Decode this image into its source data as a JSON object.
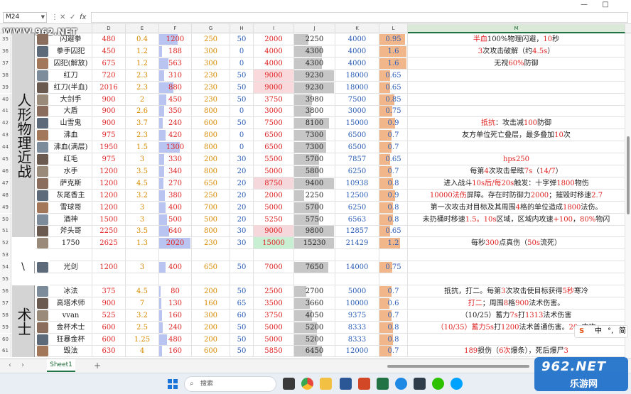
{
  "window": {
    "minimize": "—",
    "maximize": "□"
  },
  "formula_bar": {
    "name_box": "M24",
    "fx": "fx"
  },
  "watermark": "WWW.962.NET",
  "columns": [
    "D",
    "E",
    "F",
    "G",
    "H",
    "I",
    "J",
    "K",
    "L",
    "M"
  ],
  "selected_column": "M",
  "categories": [
    {
      "label": "人形物理近战",
      "first_row": 35,
      "rows": 17
    },
    {
      "label": "\\",
      "first_row": 54,
      "rows": 1
    },
    {
      "label": "术士",
      "first_row": 56,
      "rows": 6
    }
  ],
  "rows": [
    {
      "num": "35",
      "name": "闪避拳",
      "d": "480",
      "e": "0.4",
      "f": "1200",
      "g": "250",
      "h": "50",
      "i": "2000",
      "j": "2250",
      "k": "4000",
      "l": "0.95",
      "desc": [
        [
          "半血",
          1
        ],
        [
          "100%物理闪避，",
          0
        ],
        [
          "10",
          1
        ],
        [
          "秒",
          0
        ]
      ],
      "bars": {
        "f": 0.6,
        "j": 0.35,
        "l": 0.95
      }
    },
    {
      "num": "36",
      "name": "拳手囚犯",
      "d": "450",
      "e": "1.2",
      "f": "188",
      "g": "300",
      "h": "0",
      "i": "4000",
      "j": "4300",
      "k": "4000",
      "l": "1.6",
      "desc": [
        [
          "3",
          1
        ],
        [
          "次攻击破解（约",
          0
        ],
        [
          "4.5s",
          1
        ],
        [
          "）",
          0
        ]
      ],
      "bars": {
        "f": 0.1,
        "j": 0.7,
        "l": 1
      }
    },
    {
      "num": "37",
      "name": "囚犯(解放)",
      "d": "675",
      "e": "1.2",
      "f": "563",
      "g": "300",
      "h": "0",
      "i": "4000",
      "j": "4300",
      "k": "4000",
      "l": "1.6",
      "desc": [
        [
          "无视",
          0
        ],
        [
          "60%",
          1
        ],
        [
          "防御",
          0
        ]
      ],
      "bars": {
        "f": 0.3,
        "j": 0.7,
        "l": 1
      }
    },
    {
      "num": "38",
      "name": "红刀",
      "d": "720",
      "e": "2.3",
      "f": "310",
      "g": "230",
      "h": "50",
      "i": "9000",
      "j": "9230",
      "k": "18000",
      "l": "0.65",
      "desc": [],
      "bars": {
        "f": 0.15,
        "j": 1,
        "l": 0.4
      }
    },
    {
      "num": "39",
      "name": "红刀(半血)",
      "d": "2016",
      "e": "2.3",
      "f": "880",
      "g": "230",
      "h": "50",
      "i": "9000",
      "j": "9230",
      "k": "18000",
      "l": "0.65",
      "desc": [],
      "bars": {
        "f": 0.45,
        "j": 1,
        "l": 0.4
      }
    },
    {
      "num": "40",
      "name": "大剑手",
      "d": "900",
      "e": "2",
      "f": "450",
      "g": "230",
      "h": "50",
      "i": "3750",
      "j": "3980",
      "k": "7500",
      "l": "0.85",
      "desc": [],
      "bars": {
        "f": 0.22,
        "j": 0.45,
        "l": 0.55
      }
    },
    {
      "num": "41",
      "name": "大盾",
      "d": "900",
      "e": "2.6",
      "f": "350",
      "g": "800",
      "h": "0",
      "i": "3000",
      "j": "3800",
      "k": "3000",
      "l": "0.75",
      "desc": [],
      "bars": {
        "f": 0.17,
        "j": 0.42,
        "l": 0.47
      }
    },
    {
      "num": "42",
      "name": "山雪鬼",
      "d": "900",
      "e": "3.7",
      "f": "240",
      "g": "600",
      "h": "50",
      "i": "7500",
      "j": "8100",
      "k": "15000",
      "l": "0.9",
      "desc": [
        [
          "抵抗",
          1
        ],
        [
          "：攻击减",
          0
        ],
        [
          "100",
          1
        ],
        [
          "防御",
          0
        ]
      ],
      "bars": {
        "f": 0.12,
        "j": 0.88,
        "l": 0.57
      }
    },
    {
      "num": "43",
      "name": "沸血",
      "d": "975",
      "e": "2.3",
      "f": "420",
      "g": "800",
      "h": "0",
      "i": "6500",
      "j": "7300",
      "k": "6500",
      "l": "0.7",
      "desc": [
        [
          "友方单位死亡叠层，最多叠加",
          0
        ],
        [
          "10",
          1
        ],
        [
          "次",
          0
        ]
      ],
      "bars": {
        "f": 0.2,
        "j": 0.8,
        "l": 0.44
      }
    },
    {
      "num": "44",
      "name": "沸血(满层)",
      "d": "1950",
      "e": "1.5",
      "f": "1300",
      "g": "800",
      "h": "0",
      "i": "6500",
      "j": "7300",
      "k": "6500",
      "l": "0.7",
      "desc": [],
      "bars": {
        "f": 0.65,
        "j": 0.8,
        "l": 0.44
      }
    },
    {
      "num": "45",
      "name": "红毛",
      "d": "975",
      "e": "3",
      "f": "330",
      "g": "200",
      "h": "30",
      "i": "5500",
      "j": "5700",
      "k": "7857",
      "l": "0.65",
      "desc": [
        [
          "hps250",
          1
        ]
      ],
      "bars": {
        "f": 0.16,
        "j": 0.62,
        "l": 0.4
      }
    },
    {
      "num": "46",
      "name": "水手",
      "d": "1200",
      "e": "3.5",
      "f": "340",
      "g": "800",
      "h": "20",
      "i": "5000",
      "j": "5800",
      "k": "6250",
      "l": "0.7",
      "desc": [
        [
          "每第",
          0
        ],
        [
          "4",
          1
        ],
        [
          "次攻击晕眩",
          0
        ],
        [
          "7s",
          1
        ],
        [
          "（",
          0
        ],
        [
          "14/7",
          1
        ],
        [
          "）",
          0
        ]
      ],
      "bars": {
        "f": 0.17,
        "j": 0.63,
        "l": 0.44
      }
    },
    {
      "num": "47",
      "name": "萨克斯",
      "d": "1200",
      "e": "4.5",
      "f": "270",
      "g": "650",
      "h": "20",
      "i": "8750",
      "j": "9400",
      "k": "10938",
      "l": "0.8",
      "desc": [
        [
          "进入战斗",
          0
        ],
        [
          "10s后/每20s",
          1
        ],
        [
          "触发：十字弹",
          0
        ],
        [
          "1800",
          1
        ],
        [
          "物伤",
          0
        ]
      ],
      "bars": {
        "f": 0.13,
        "j": 1,
        "l": 0.5
      }
    },
    {
      "num": "48",
      "name": "灰尾香主",
      "d": "1200",
      "e": "3.2",
      "f": "380",
      "g": "250",
      "h": "20",
      "i": "2000",
      "j": "2250",
      "k": "12500",
      "l": "0.9",
      "desc": [
        [
          "10000法伤",
          1
        ],
        [
          "屏障。存在时防御力",
          0
        ],
        [
          "2000",
          1
        ],
        [
          "；摧毁时移速",
          0
        ],
        [
          "2.7",
          1
        ]
      ],
      "bars": {
        "f": 0.18,
        "j": 0.25,
        "l": 0.57
      }
    },
    {
      "num": "49",
      "name": "雪球哥",
      "d": "1200",
      "e": "3",
      "f": "400",
      "g": "700",
      "h": "20",
      "i": "5000",
      "j": "5700",
      "k": "6250",
      "l": "0.8",
      "desc": [
        [
          "第一次攻击对目标及其周围",
          0
        ],
        [
          "4",
          1
        ],
        [
          "格的单位造成",
          0
        ],
        [
          "1800",
          1
        ],
        [
          "法伤。",
          0
        ]
      ],
      "bars": {
        "f": 0.2,
        "j": 0.62,
        "l": 0.5
      }
    },
    {
      "num": "50",
      "name": "酒神",
      "d": "1500",
      "e": "3",
      "f": "500",
      "g": "500",
      "h": "20",
      "i": "5250",
      "j": "5750",
      "k": "6563",
      "l": "0.8",
      "desc": [
        [
          "未扔桶时移速",
          0
        ],
        [
          "1.5。10s",
          1
        ],
        [
          "区域，区域内攻速",
          0
        ],
        [
          "+100",
          1
        ],
        [
          "，",
          0
        ],
        [
          "80%",
          1
        ],
        [
          "物闪",
          0
        ]
      ],
      "bars": {
        "f": 0.25,
        "j": 0.63,
        "l": 0.5
      }
    },
    {
      "num": "51",
      "name": "斧头哥",
      "d": "2250",
      "e": "3.5",
      "f": "640",
      "g": "800",
      "h": "30",
      "i": "9000",
      "j": "9800",
      "k": "12857",
      "l": "0.65",
      "desc": [],
      "bars": {
        "f": 0.32,
        "j": 1,
        "l": 0.4
      }
    },
    {
      "num": "52",
      "name": "1750",
      "d": "2625",
      "e": "1.3",
      "f": "2020",
      "g": "230",
      "h": "30",
      "i": "15000",
      "j": "15230",
      "k": "21429",
      "l": "1.2",
      "desc": [
        [
          "每秒",
          0
        ],
        [
          "300",
          1
        ],
        [
          "点真伤（",
          0
        ],
        [
          "50s",
          1
        ],
        [
          "流死）",
          0
        ]
      ],
      "bars": {
        "f": 1,
        "j": 1,
        "l": 0.75
      }
    },
    {
      "num": "53",
      "name": "",
      "d": "",
      "e": "",
      "f": "",
      "g": "",
      "h": "",
      "i": "",
      "j": "",
      "k": "",
      "l": "",
      "desc": [],
      "bars": {}
    },
    {
      "num": "54",
      "name": "光剑",
      "d": "1200",
      "e": "3",
      "f": "400",
      "g": "650",
      "h": "50",
      "i": "7000",
      "j": "7650",
      "k": "14000",
      "l": "0.75",
      "desc": [],
      "bars": {
        "f": 0.2,
        "j": 0.85,
        "l": 0.47
      }
    },
    {
      "num": "55",
      "name": "",
      "d": "",
      "e": "",
      "f": "",
      "g": "",
      "h": "",
      "i": "",
      "j": "",
      "k": "",
      "l": "",
      "desc": [],
      "bars": {}
    },
    {
      "num": "56",
      "name": "冰法",
      "d": "375",
      "e": "4.5",
      "f": "80",
      "g": "200",
      "h": "50",
      "i": "2500",
      "j": "2700",
      "k": "5000",
      "l": "0.7",
      "desc": [
        [
          "抵抗，打二。每第",
          0
        ],
        [
          "3",
          1
        ],
        [
          "次攻击使目标获得",
          0
        ],
        [
          "5秒",
          1
        ],
        [
          "寒冷",
          0
        ]
      ],
      "bars": {
        "f": 0.04,
        "j": 0.3,
        "l": 0.44
      }
    },
    {
      "num": "57",
      "name": "高塔术师",
      "d": "900",
      "e": "7",
      "f": "130",
      "g": "160",
      "h": "65",
      "i": "3500",
      "j": "3660",
      "k": "10000",
      "l": "0.6",
      "desc": [
        [
          "打二",
          1
        ],
        [
          "；周围",
          0
        ],
        [
          "8",
          1
        ],
        [
          "格",
          0
        ],
        [
          "900",
          1
        ],
        [
          "法术伤害。",
          0
        ]
      ],
      "bars": {
        "f": 0.06,
        "j": 0.4,
        "l": 0.37
      }
    },
    {
      "num": "58",
      "name": "vvan",
      "d": "525",
      "e": "3.2",
      "f": "160",
      "g": "300",
      "h": "60",
      "i": "3750",
      "j": "4050",
      "k": "9375",
      "l": "0.7",
      "desc": [
        [
          "（10/25）蓄力",
          0
        ],
        [
          "7s",
          1
        ],
        [
          "打",
          0
        ],
        [
          "1313",
          1
        ],
        [
          "法术伤害",
          0
        ]
      ],
      "bars": {
        "f": 0.08,
        "j": 0.45,
        "l": 0.44
      }
    },
    {
      "num": "59",
      "name": "金杯术士",
      "d": "600",
      "e": "2.5",
      "f": "240",
      "g": "200",
      "h": "50",
      "i": "5000",
      "j": "5200",
      "k": "8333",
      "l": "0.8",
      "desc": [
        [
          "（10/35）蓄力",
          1
        ],
        [
          "5s",
          1
        ],
        [
          "打",
          0
        ],
        [
          "1200",
          1
        ],
        [
          "法术普通伤害。",
          0
        ],
        [
          "20s",
          1
        ],
        [
          "内攻",
          0
        ]
      ],
      "bars": {
        "f": 0.12,
        "j": 0.57,
        "l": 0.5
      }
    },
    {
      "num": "60",
      "name": "狂暴金杯",
      "d": "600",
      "e": "1.25",
      "f": "480",
      "g": "200",
      "h": "50",
      "i": "5000",
      "j": "5200",
      "k": "8333",
      "l": "0.8",
      "desc": [],
      "bars": {
        "f": 0.24,
        "j": 0.57,
        "l": 0.5
      }
    },
    {
      "num": "61",
      "name": "毁法",
      "d": "630",
      "e": "4",
      "f": "160",
      "g": "600",
      "h": "50",
      "i": "5850",
      "j": "6450",
      "k": "12000",
      "l": "0.7",
      "desc": [
        [
          "189",
          1
        ],
        [
          "损伤（",
          0
        ],
        [
          "6次",
          1
        ],
        [
          "爆条），死后爆尸",
          0
        ],
        [
          "3",
          1
        ]
      ],
      "bars": {
        "f": 0.08,
        "j": 0.7,
        "l": 0.44
      }
    }
  ],
  "sheet": {
    "tab": "Sheet1",
    "add": "+"
  },
  "taskbar": {
    "search_placeholder": "搜索"
  },
  "ime": {
    "mode": "中",
    "punct": "°,",
    "width": "简"
  },
  "logo": {
    "big": "962.NET",
    "small": "乐游网"
  },
  "colors": {
    "excel_green": "#217346",
    "red": "#e02525",
    "blue": "#2d5fb7",
    "orange": "#d98a00",
    "green": "#2e9f4b"
  }
}
